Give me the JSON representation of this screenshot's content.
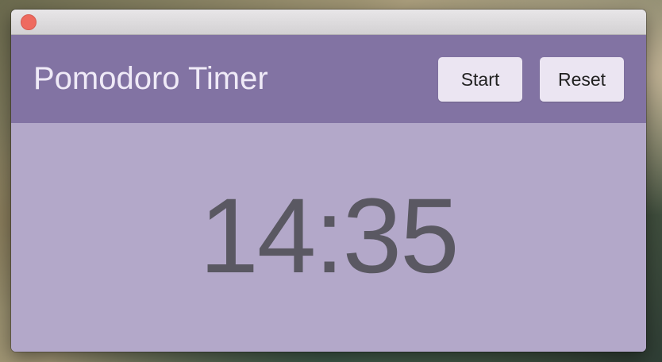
{
  "window": {
    "title": ""
  },
  "header": {
    "title": "Pomodoro Timer",
    "start_label": "Start",
    "reset_label": "Reset"
  },
  "timer": {
    "display": "14:35"
  },
  "colors": {
    "header_bg": "#8273a3",
    "body_bg": "#b3a8c9",
    "button_bg": "#ebe5f2",
    "timer_text": "#5a5862",
    "close_button": "#ee6a5f"
  }
}
